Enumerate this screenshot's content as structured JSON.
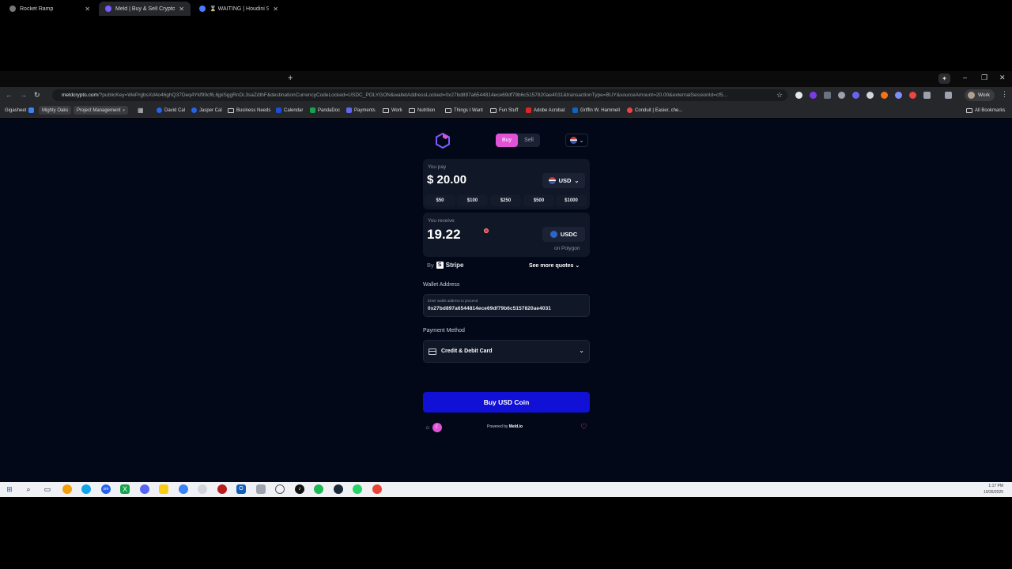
{
  "browser": {
    "tabs": [
      {
        "title": "Rocket Ramp",
        "color": "#888888"
      },
      {
        "title": "Meld | Buy & Sell Crypto",
        "color": "#7c5cff"
      },
      {
        "title": "⌛ WAITING | Houdini Swap | S...",
        "color": "#4a7cff"
      }
    ],
    "url_host": "meldcrypto.com",
    "url_rest": "/?publicKey=WePrgbsXd4o46ghQ37Deq4Ykf99cf6,6jpiSggRnDi,3saZdthF&destinationCurrencyCodeLocked=USDC_POLYGON&walletAddressLocked=0x27bd897a6544814ece69df79b6c5157820ae4031&transactionType=BUY&sourceAmount=20.00&externalSessionId=cf5...",
    "profile_label": "Work",
    "bookmarks": [
      {
        "label": "Gigasheet",
        "color": "#3b82f6"
      },
      {
        "label": "Mighty Oaks",
        "color": "#a16207"
      },
      {
        "label": "Project Management",
        "color": "#6b7280"
      },
      {
        "label": "David Cal",
        "color": "#2563eb"
      },
      {
        "label": "Jasper Cal",
        "color": "#2563eb"
      },
      {
        "label": "Business Needs",
        "color": ""
      },
      {
        "label": "Calendar",
        "color": "#1d4ed8"
      },
      {
        "label": "PandaDoc",
        "color": "#16a34a"
      },
      {
        "label": "Payments",
        "color": "#6366f1"
      },
      {
        "label": "Work",
        "color": ""
      },
      {
        "label": "Nutrition",
        "color": ""
      },
      {
        "label": "Things I Want",
        "color": ""
      },
      {
        "label": "Fun Stuff",
        "color": ""
      },
      {
        "label": "Adobe Acrobat",
        "color": "#dc2626"
      },
      {
        "label": "Griffin W. Hammell",
        "color": "#0a66c2"
      },
      {
        "label": "Conduit | Easier, che...",
        "color": "#ef4444"
      }
    ],
    "all_bookmarks": "All Bookmarks"
  },
  "widget": {
    "mode": {
      "buy": "Buy",
      "sell": "Sell"
    },
    "pay": {
      "caption": "You pay",
      "currency_symbol": "$",
      "amount": "20.00",
      "currency": "USD",
      "presets": [
        "$50",
        "$100",
        "$250",
        "$500",
        "$1000"
      ]
    },
    "receive": {
      "caption": "You receive",
      "amount": "19.22",
      "currency": "USDC",
      "network": "on Polygon"
    },
    "provider": {
      "by": "By",
      "name": "Stripe",
      "more_quotes": "See more quotes"
    },
    "wallet": {
      "label": "Wallet Address",
      "placeholder": "Enter wallet address to proceed",
      "value": "0x27bd897a6544814ece69df79b6c5157820ae4031"
    },
    "payment": {
      "label": "Payment Method",
      "value": "Credit & Debit Card"
    },
    "buy_button": "Buy USD Coin",
    "powered_prefix": "Powered by",
    "powered_brand": "Meld.io",
    "accent": "#e052d6",
    "button_color": "#1010d6"
  },
  "taskbar": {
    "time": "1:17 PM",
    "date": "10/26/2025"
  }
}
